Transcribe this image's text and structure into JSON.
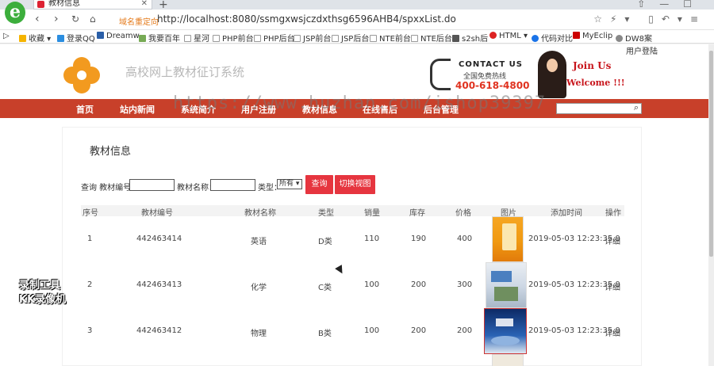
{
  "browser": {
    "tab_title": "教材信息",
    "address_badge": "域名重定向",
    "url": "http://localhost:8080/ssmgxwsjczdxthsg6596AHB4/spxxList.do",
    "bookmarks": [
      "收藏",
      "登录QQ",
      "Dreamw",
      "我要百年",
      "星河",
      "PHP前台",
      "PHP后台",
      "JSP前台",
      "JSP后台",
      "NTE前台",
      "NTE后台",
      "s2sh后",
      "HTML",
      "代码对比",
      "MyEclip",
      "DW8案"
    ]
  },
  "header": {
    "site_title": "高校网上教材征订系统",
    "contact_title": "CONTACT US",
    "contact_sub": "全国免费热线",
    "phone": "400-618-4800",
    "join_line1": "Join Us",
    "join_line2": "Welcome !!!",
    "user_login": "用户登陆",
    "watermark": "https://www.huzhan.com/ishop39397"
  },
  "menu": {
    "items": [
      "首页",
      "站内新闻",
      "系统简介",
      "用户注册",
      "教材信息",
      "在线售后",
      "后台管理"
    ]
  },
  "content": {
    "title": "教材信息",
    "filter_prefix": "查询 教材编号：",
    "filter_name_label": "教材名称：",
    "filter_type_label": "类型：",
    "filter_type_value": "所有",
    "query_button": "查询",
    "switch_button": "切换视图"
  },
  "table": {
    "headers": [
      "序号",
      "教材编号",
      "教材名称",
      "类型",
      "销量",
      "库存",
      "价格",
      "图片",
      "添加时间",
      "操作"
    ],
    "rows": [
      {
        "no": "1",
        "code": "442463414",
        "name": "英语",
        "type": "D类",
        "sales": "110",
        "stock": "190",
        "price": "400",
        "time": "2019-05-03 12:23:35.0",
        "action": "详细"
      },
      {
        "no": "2",
        "code": "442463413",
        "name": "化学",
        "type": "C类",
        "sales": "100",
        "stock": "200",
        "price": "300",
        "time": "2019-05-03 12:23:35.0",
        "action": "详细"
      },
      {
        "no": "3",
        "code": "442463412",
        "name": "物理",
        "type": "B类",
        "sales": "100",
        "stock": "200",
        "price": "200",
        "time": "2019-05-03 12:23:35.0",
        "action": "详细"
      }
    ]
  },
  "overlay": {
    "recorder_line1": "录制工具",
    "recorder_line2": "KK录像机"
  },
  "colors": {
    "menu_bar": "#c8402a",
    "button_red": "#e6353f",
    "phone_red": "#e0321f",
    "logo_orange": "#f29a1f"
  }
}
